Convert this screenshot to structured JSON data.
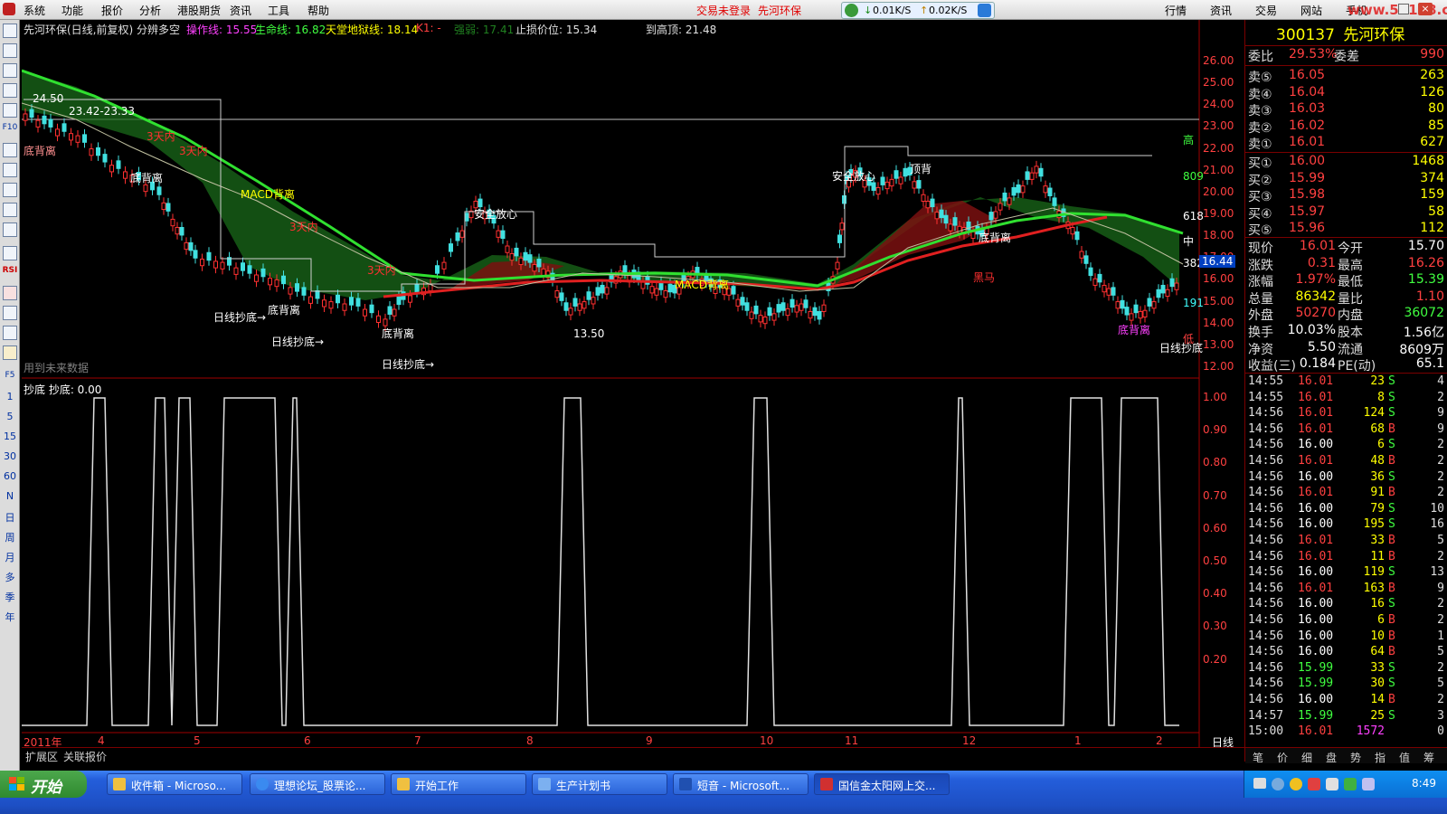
{
  "menubar": {
    "items": [
      "系统",
      "功能",
      "报价",
      "分析",
      "港股期货",
      "资讯",
      "工具",
      "帮助"
    ],
    "status_left": "交易未登录",
    "status_stock": "先河环保",
    "net_down": "0.01K/S",
    "net_up": "0.02K/S",
    "right_items": [
      "行情",
      "资讯",
      "交易",
      "网站",
      "手机"
    ],
    "watermark": "www.55188.com"
  },
  "left_toolbar": {
    "periods": [
      "1",
      "5",
      "15",
      "30",
      "60",
      "N",
      "日",
      "周",
      "月",
      "多",
      "季",
      "年"
    ],
    "tools": [
      "F10",
      "F5",
      "RSI"
    ]
  },
  "main_chart": {
    "header": {
      "title": "先河环保(日线,前复权) 分辨多空",
      "op_line": "操作线: 15.55",
      "life_line": "生命线: 16.82",
      "heaven_hell": "天堂地狱线: 18.14",
      "k1": "K1: -",
      "strength": "强弱: 17.41",
      "stop_loss": "止损价位: 15.34",
      "to_top": "到高顶: 21.48"
    },
    "price_axis": [
      "26.00",
      "25.00",
      "24.00",
      "23.00",
      "22.00",
      "21.00",
      "20.00",
      "19.00",
      "18.00",
      "17.00",
      "16.00",
      "15.00",
      "14.00",
      "13.00",
      "12.00"
    ],
    "right_markers": {
      "high": "高",
      "mid": "中",
      "low": "低",
      "r809": "809",
      "r618": "618",
      "r382": "382",
      "r191": "191",
      "cur_price": "16.44"
    },
    "annotations": {
      "range_label": "23.42-23.33",
      "top_price": "24.50",
      "bottom_price": "13.50",
      "bottom_divergence": "底背离",
      "macd_divergence": "MACD背离",
      "three_day": "3天内",
      "daily_bottom": "日线抄底→",
      "safe": "安全放心",
      "black_horse": "黑马",
      "top_divergence": "顶背",
      "future_data": "用到未来数据",
      "daily_bottom_end": "日线抄底"
    }
  },
  "sub_chart": {
    "title": "抄底 抄底: 0.00",
    "axis": [
      "1.00",
      "0.90",
      "0.80",
      "0.70",
      "0.60",
      "0.50",
      "0.40",
      "0.30",
      "0.20"
    ]
  },
  "time_axis": {
    "year": "2011年",
    "months": [
      "4",
      "5",
      "6",
      "7",
      "8",
      "9",
      "10",
      "11",
      "12",
      "1",
      "2"
    ],
    "period": "日线"
  },
  "bottom_tabs": [
    "扩展区",
    "关联报价"
  ],
  "quote": {
    "code": "300137",
    "name": "先河环保",
    "weibi_label": "委比",
    "weibi": "29.53%",
    "weicha_label": "委差",
    "weicha": "990",
    "asks": [
      {
        "label": "卖⑤",
        "price": "16.05",
        "vol": "263"
      },
      {
        "label": "卖④",
        "price": "16.04",
        "vol": "126"
      },
      {
        "label": "卖③",
        "price": "16.03",
        "vol": "80"
      },
      {
        "label": "卖②",
        "price": "16.02",
        "vol": "85"
      },
      {
        "label": "卖①",
        "price": "16.01",
        "vol": "627"
      }
    ],
    "bids": [
      {
        "label": "买①",
        "price": "16.00",
        "vol": "1468"
      },
      {
        "label": "买②",
        "price": "15.99",
        "vol": "374"
      },
      {
        "label": "买③",
        "price": "15.98",
        "vol": "159"
      },
      {
        "label": "买④",
        "price": "15.97",
        "vol": "58"
      },
      {
        "label": "买⑤",
        "price": "15.96",
        "vol": "112"
      }
    ],
    "stats": [
      {
        "l1": "现价",
        "v1": "16.01",
        "l2": "今开",
        "v2": "15.70",
        "c1": "#ff4040",
        "c2": "#ffffff"
      },
      {
        "l1": "涨跌",
        "v1": "0.31",
        "l2": "最高",
        "v2": "16.26",
        "c1": "#ff4040",
        "c2": "#ff4040"
      },
      {
        "l1": "涨幅",
        "v1": "1.97%",
        "l2": "最低",
        "v2": "15.39",
        "c1": "#ff4040",
        "c2": "#40ff40"
      },
      {
        "l1": "总量",
        "v1": "86342",
        "l2": "量比",
        "v2": "1.10",
        "c1": "#ffff00",
        "c2": "#ff4040"
      },
      {
        "l1": "外盘",
        "v1": "50270",
        "l2": "内盘",
        "v2": "36072",
        "c1": "#ff4040",
        "c2": "#40ff40"
      },
      {
        "l1": "换手",
        "v1": "10.03%",
        "l2": "股本",
        "v2": "1.56亿",
        "c1": "#ffffff",
        "c2": "#ffffff"
      },
      {
        "l1": "净资",
        "v1": "5.50",
        "l2": "流通",
        "v2": "8609万",
        "c1": "#ffffff",
        "c2": "#ffffff"
      },
      {
        "l1": "收益(三)",
        "v1": "0.184",
        "l2": "PE(动)",
        "v2": "65.1",
        "c1": "#ffffff",
        "c2": "#ffffff"
      }
    ],
    "ticks": [
      {
        "t": "14:55",
        "p": "16.01",
        "v": "23",
        "bs": "S",
        "n": "4"
      },
      {
        "t": "14:55",
        "p": "16.01",
        "v": "8",
        "bs": "S",
        "n": "2"
      },
      {
        "t": "14:56",
        "p": "16.01",
        "v": "124",
        "bs": "S",
        "n": "9"
      },
      {
        "t": "14:56",
        "p": "16.01",
        "v": "68",
        "bs": "B",
        "n": "9"
      },
      {
        "t": "14:56",
        "p": "16.00",
        "v": "6",
        "bs": "S",
        "n": "2"
      },
      {
        "t": "14:56",
        "p": "16.01",
        "v": "48",
        "bs": "B",
        "n": "2"
      },
      {
        "t": "14:56",
        "p": "16.00",
        "v": "36",
        "bs": "S",
        "n": "2"
      },
      {
        "t": "14:56",
        "p": "16.01",
        "v": "91",
        "bs": "B",
        "n": "2"
      },
      {
        "t": "14:56",
        "p": "16.00",
        "v": "79",
        "bs": "S",
        "n": "10"
      },
      {
        "t": "14:56",
        "p": "16.00",
        "v": "195",
        "bs": "S",
        "n": "16"
      },
      {
        "t": "14:56",
        "p": "16.01",
        "v": "33",
        "bs": "B",
        "n": "5"
      },
      {
        "t": "14:56",
        "p": "16.01",
        "v": "11",
        "bs": "B",
        "n": "2"
      },
      {
        "t": "14:56",
        "p": "16.00",
        "v": "119",
        "bs": "S",
        "n": "13"
      },
      {
        "t": "14:56",
        "p": "16.01",
        "v": "163",
        "bs": "B",
        "n": "9"
      },
      {
        "t": "14:56",
        "p": "16.00",
        "v": "16",
        "bs": "S",
        "n": "2"
      },
      {
        "t": "14:56",
        "p": "16.00",
        "v": "6",
        "bs": "B",
        "n": "2"
      },
      {
        "t": "14:56",
        "p": "16.00",
        "v": "10",
        "bs": "B",
        "n": "1"
      },
      {
        "t": "14:56",
        "p": "16.00",
        "v": "64",
        "bs": "B",
        "n": "5"
      },
      {
        "t": "14:56",
        "p": "15.99",
        "v": "33",
        "bs": "S",
        "n": "2"
      },
      {
        "t": "14:56",
        "p": "15.99",
        "v": "30",
        "bs": "S",
        "n": "5"
      },
      {
        "t": "14:56",
        "p": "16.00",
        "v": "14",
        "bs": "B",
        "n": "2"
      },
      {
        "t": "14:57",
        "p": "15.99",
        "v": "25",
        "bs": "S",
        "n": "3"
      },
      {
        "t": "15:00",
        "p": "16.01",
        "v": "1572",
        "bs": "",
        "n": "0"
      }
    ],
    "tabs": [
      "笔",
      "价",
      "细",
      "盘",
      "势",
      "指",
      "值",
      "筹"
    ]
  },
  "taskbar": {
    "start": "开始",
    "tasks": [
      "收件箱 - Microso...",
      "理想论坛_股票论...",
      "开始工作",
      "生产计划书",
      "短音 - Microsoft...",
      "国信金太阳网上交..."
    ],
    "clock": "8:49"
  }
}
